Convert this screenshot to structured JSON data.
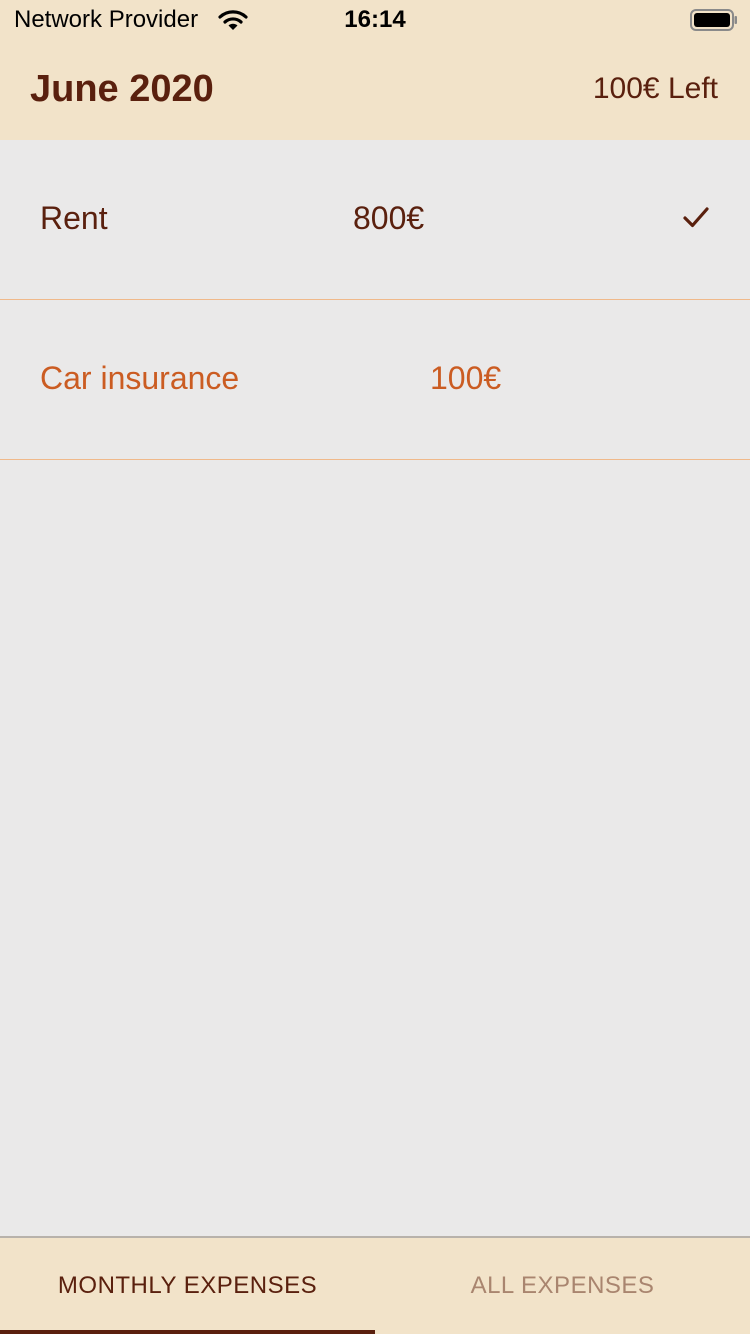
{
  "status_bar": {
    "carrier": "Network Provider",
    "time": "16:14",
    "wifi_icon": "wifi-icon",
    "battery_icon": "battery-icon"
  },
  "header": {
    "title": "June 2020",
    "remaining": "100€ Left"
  },
  "expenses": [
    {
      "name": "Rent",
      "amount": "800€",
      "paid": true
    },
    {
      "name": "Car insurance",
      "amount": "100€",
      "paid": false
    }
  ],
  "tabs": [
    {
      "label": "MONTHLY EXPENSES",
      "active": true
    },
    {
      "label": "ALL EXPENSES",
      "active": false
    }
  ],
  "colors": {
    "header_bg": "#f2e3c9",
    "list_bg": "#eae9e9",
    "primary_text": "#5a200e",
    "unpaid_text": "#cb5c22",
    "divider": "#f0b98a",
    "inactive_tab": "#a9856f"
  }
}
